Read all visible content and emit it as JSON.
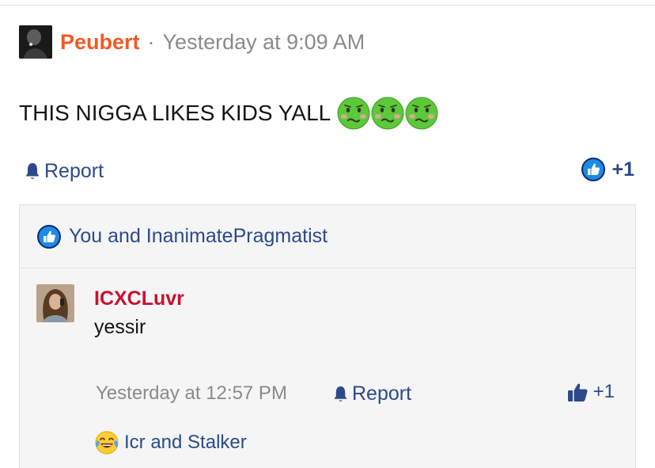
{
  "post": {
    "author": "Peubert",
    "separator": "·",
    "time": "Yesterday at 9:09 AM",
    "body": "THIS NIGGA LIKES KIDS YALL",
    "emojis": [
      "nauseated-face-icon",
      "nauseated-face-icon",
      "nauseated-face-icon"
    ],
    "report_label": "Report",
    "like_count": "+1"
  },
  "reactions": {
    "text": "You and InanimatePragmatist"
  },
  "comment": {
    "author": "ICXCLuvr",
    "text": "yessir",
    "time": "Yesterday at 12:57 PM",
    "report_label": "Report",
    "like_count": "+1",
    "reacted_by": "Icr and Stalker"
  },
  "colors": {
    "post_author": "#f15a24",
    "comment_author": "#c8102e",
    "link": "#2b4a8b",
    "muted": "#8a8a8a"
  }
}
